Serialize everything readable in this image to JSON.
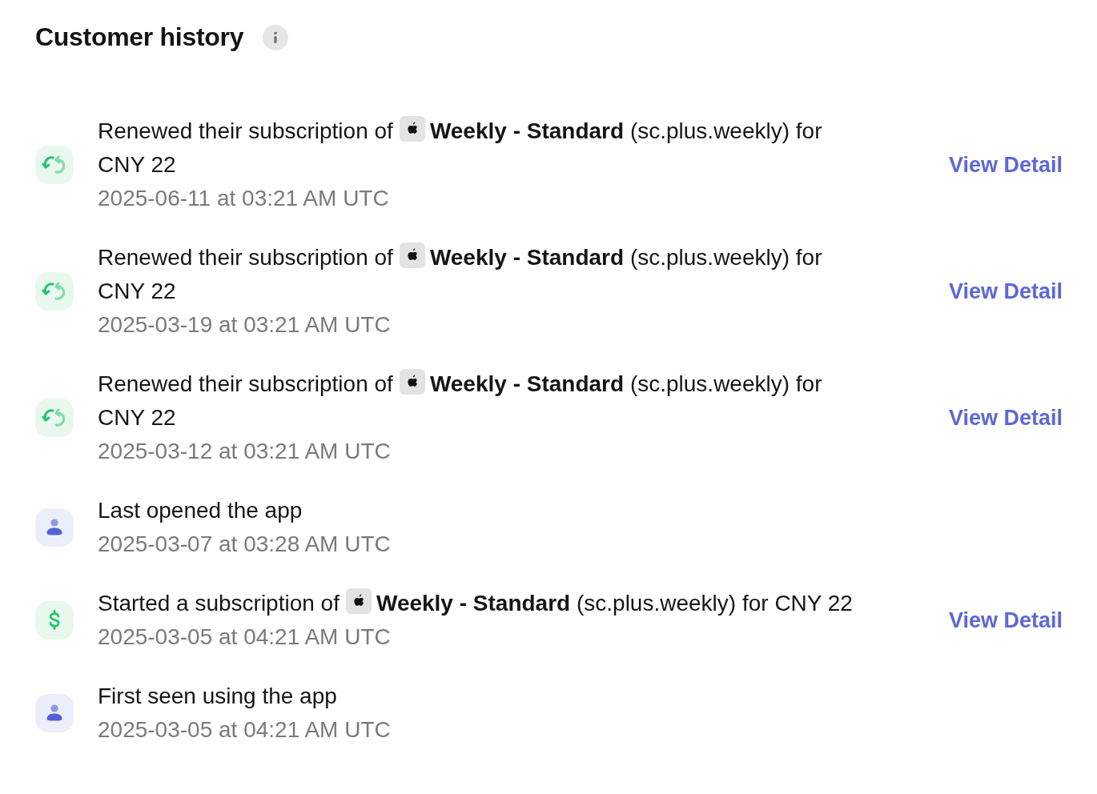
{
  "title": "Customer history",
  "events": [
    {
      "kind": "renewal",
      "lead": "Renewed their subscription of",
      "store_badge": true,
      "rest": "**Weekly - Standard** (sc.plus.weekly) for",
      "price": "CNY 22",
      "date": "2025-06-11 at 03:21 AM UTC",
      "link": "View Detail"
    },
    {
      "kind": "renewal",
      "lead": "Renewed their subscription of",
      "store_badge": true,
      "rest": "**Weekly - Standard** (sc.plus.weekly) for",
      "price": "CNY 22",
      "date": "2025-03-19 at 03:21 AM UTC",
      "link": "View Detail"
    },
    {
      "kind": "renewal",
      "lead": "Renewed their subscription of",
      "store_badge": true,
      "rest": "**Weekly - Standard** (sc.plus.weekly) for",
      "price": "CNY 22",
      "date": "2025-03-12 at 03:21 AM UTC",
      "link": "View Detail"
    },
    {
      "kind": "opened",
      "lead": "Last opened the app",
      "date": "2025-03-07 at 03:28 AM UTC"
    },
    {
      "kind": "started",
      "lead": "Started a subscription of",
      "store_badge": true,
      "rest": "**Weekly - Standard** (sc.plus.weekly) for",
      "price": "CNY 22",
      "date": "2025-03-05 at 04:21 AM UTC",
      "link": "View Detail"
    },
    {
      "kind": "opened",
      "lead": "First seen using the app",
      "date": "2025-03-05 at 04:21 AM UTC"
    }
  ]
}
